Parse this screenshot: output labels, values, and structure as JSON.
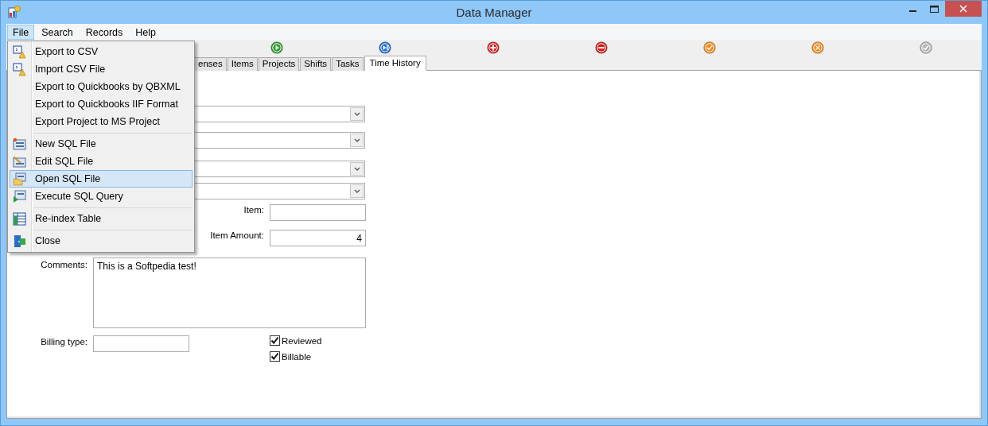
{
  "window": {
    "title": "Data Manager"
  },
  "menubar": [
    {
      "label": "File",
      "selected": true
    },
    {
      "label": "Search",
      "selected": false
    },
    {
      "label": "Records",
      "selected": false
    },
    {
      "label": "Help",
      "selected": false
    }
  ],
  "toolbar": [
    {
      "kind": "play",
      "disabled": false
    },
    {
      "kind": "next",
      "disabled": false
    },
    {
      "kind": "add",
      "disabled": false
    },
    {
      "kind": "remove",
      "disabled": false
    },
    {
      "kind": "confirm",
      "disabled": false
    },
    {
      "kind": "cancel",
      "disabled": false
    },
    {
      "kind": "confirm",
      "disabled": true
    }
  ],
  "tabs": [
    {
      "label": "enses",
      "selected": false
    },
    {
      "label": "Items",
      "selected": false
    },
    {
      "label": "Projects",
      "selected": false
    },
    {
      "label": "Shifts",
      "selected": false
    },
    {
      "label": "Tasks",
      "selected": false
    },
    {
      "label": "Time History",
      "selected": true
    }
  ],
  "form": {
    "item": {
      "label": "Item:"
    },
    "item_amount": {
      "label": "Item Amount:",
      "value": "4"
    },
    "comments": {
      "label": "Comments:",
      "value": "This is a Softpedia test!"
    },
    "billing_type": {
      "label": "Billing type:"
    },
    "checkboxes": [
      {
        "label": "Reviewed",
        "checked": true
      },
      {
        "label": "Billable",
        "checked": true
      }
    ]
  },
  "file_menu": {
    "groups": [
      [
        {
          "label": "Export to CSV",
          "kind": "export",
          "selected": false
        },
        {
          "label": "Import CSV File",
          "kind": "export",
          "selected": false
        },
        {
          "label": "Export to Quickbooks by  QBXML",
          "selected": false
        },
        {
          "label": "Export to Quickbooks IIF Format",
          "selected": false
        },
        {
          "label": "Export Project to MS Project",
          "selected": false
        }
      ],
      [
        {
          "label": "New SQL File",
          "kind": "new",
          "selected": false
        },
        {
          "label": "Edit SQL File",
          "kind": "edit",
          "selected": false
        },
        {
          "label": "Open SQL File",
          "kind": "open",
          "selected": true
        },
        {
          "label": "Execute SQL Query",
          "kind": "run",
          "selected": false
        }
      ],
      [
        {
          "label": "Re-index Table",
          "kind": "table",
          "selected": false
        }
      ],
      [
        {
          "label": "Close",
          "kind": "door",
          "selected": false
        }
      ]
    ]
  }
}
